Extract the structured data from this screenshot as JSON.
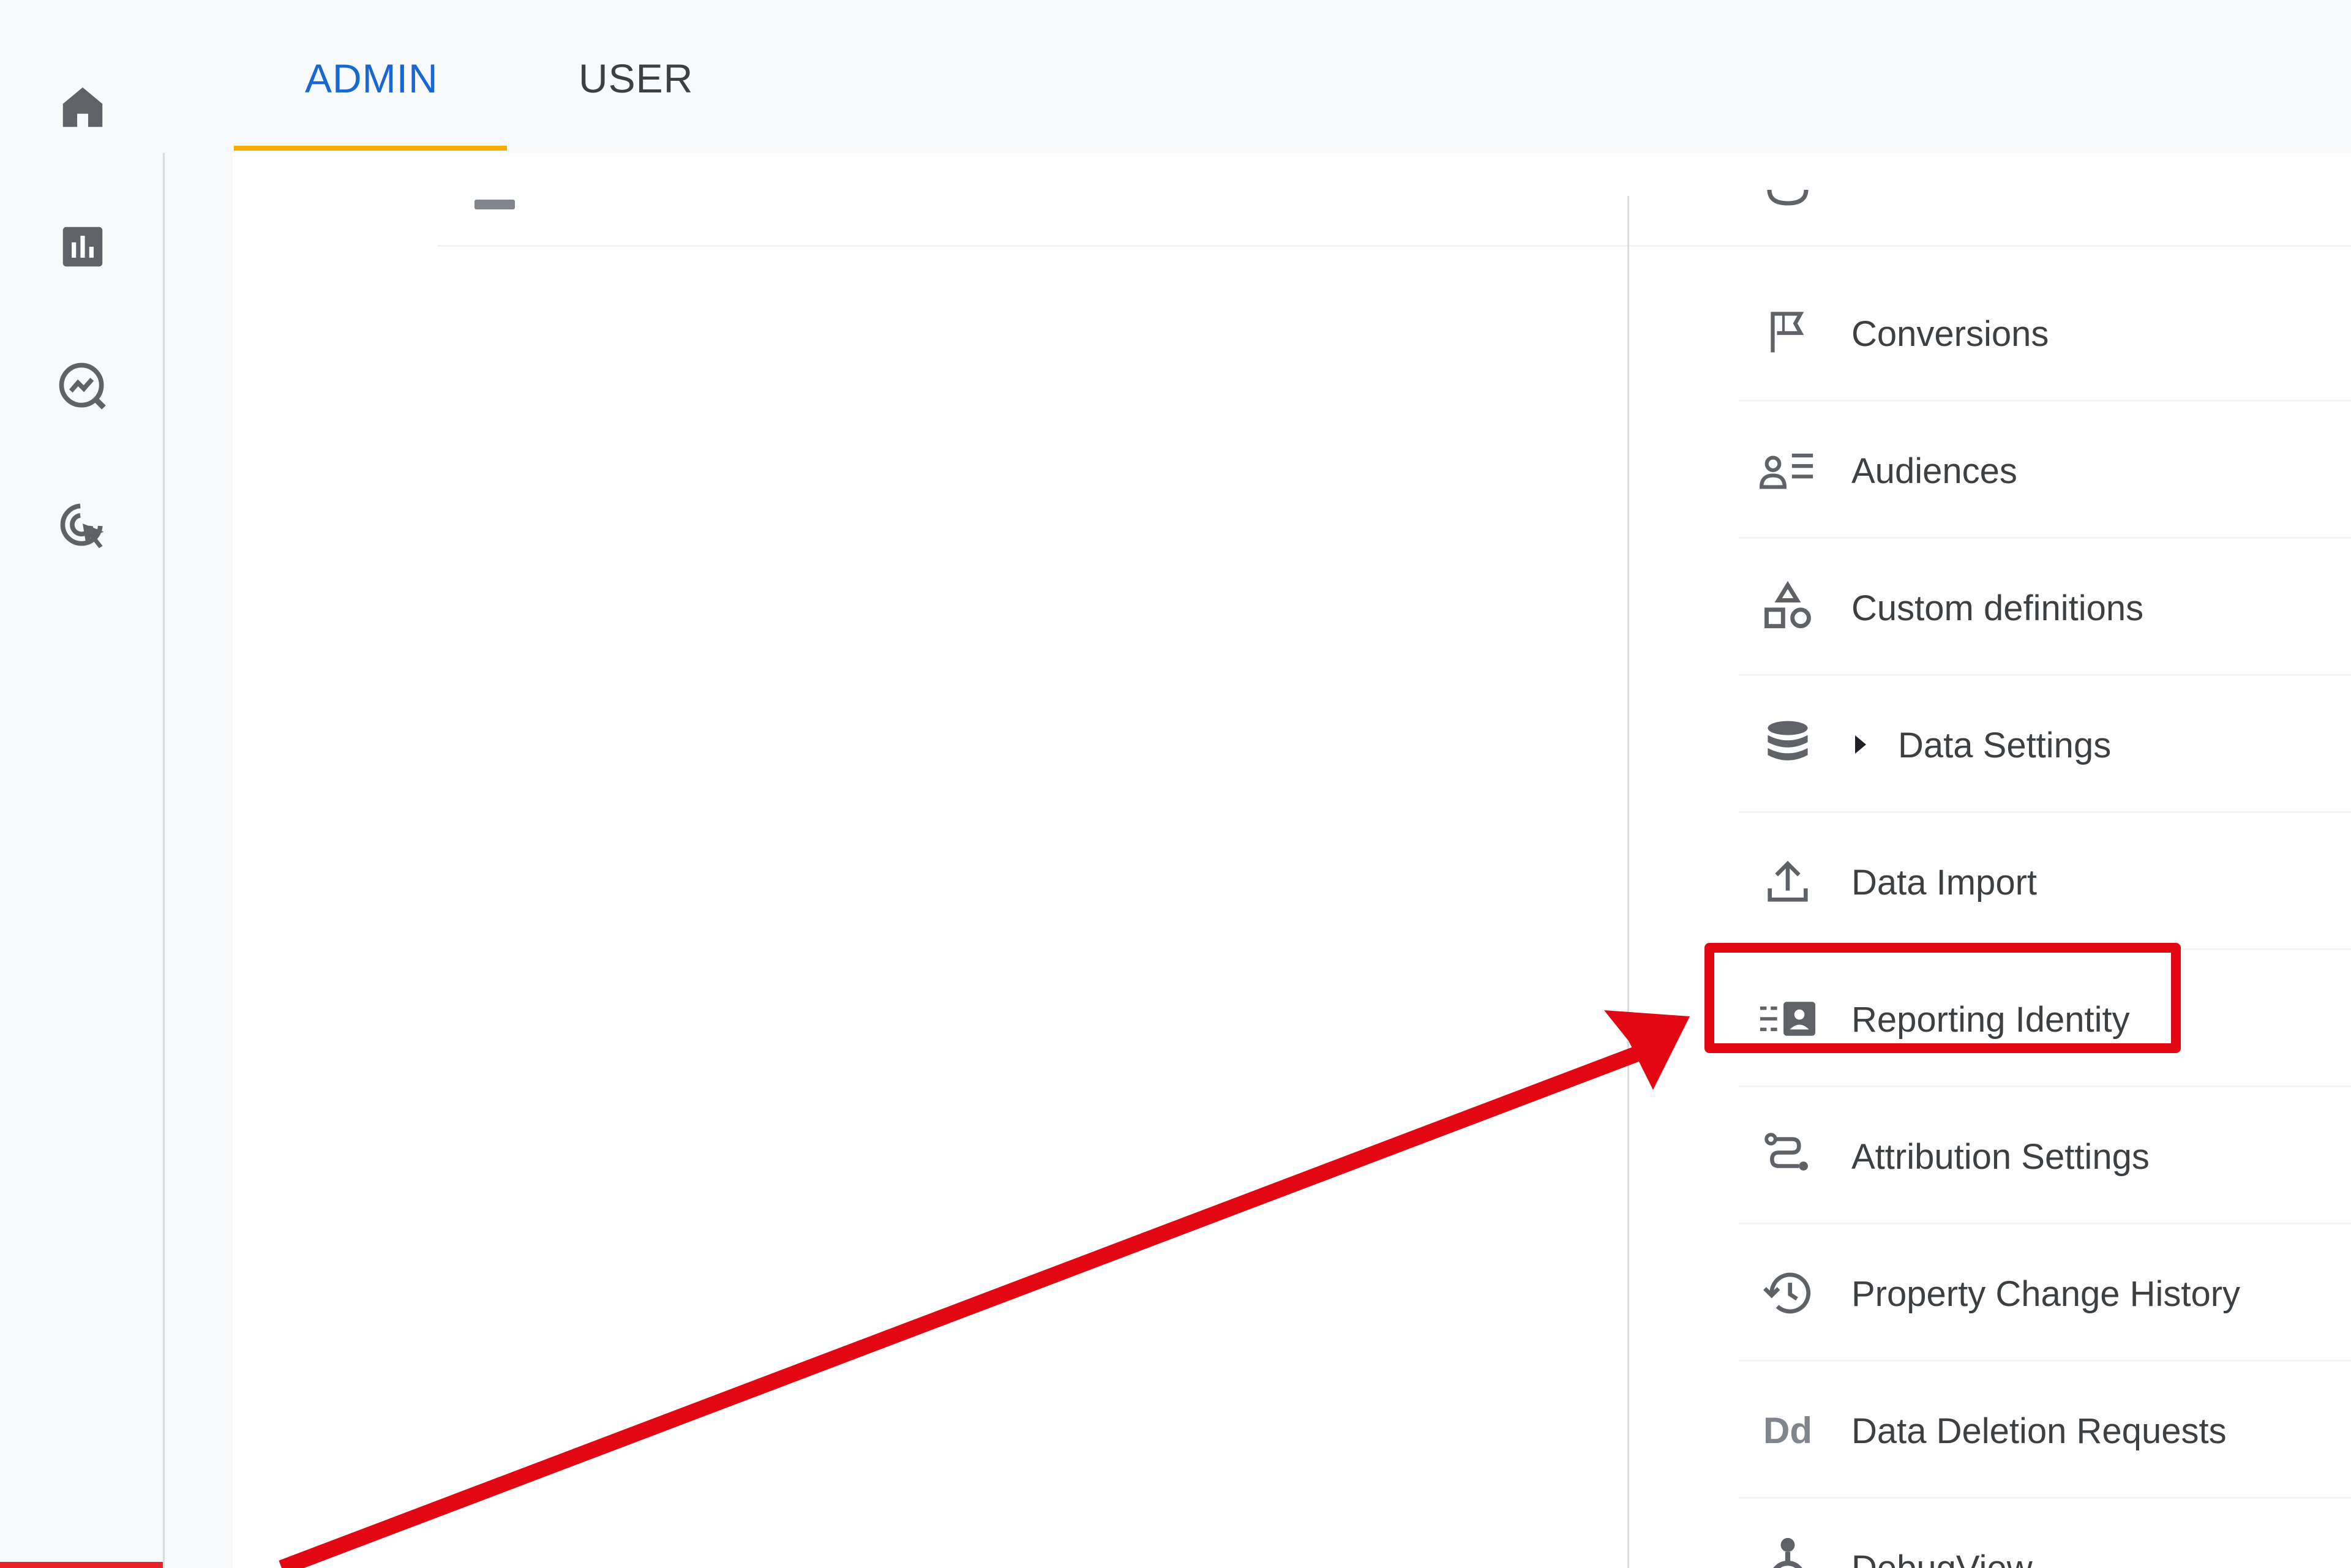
{
  "tabs": {
    "admin_label": "ADMIN",
    "user_label": "USER",
    "active": "ADMIN"
  },
  "rail": {
    "icons": [
      "home-icon",
      "reports-icon",
      "explore-icon",
      "advertising-icon"
    ]
  },
  "menu": {
    "items": [
      {
        "label": "Conversions",
        "icon": "flag-icon"
      },
      {
        "label": "Audiences",
        "icon": "audiences-icon"
      },
      {
        "label": "Custom definitions",
        "icon": "shapes-icon"
      },
      {
        "label": "Data Settings",
        "icon": "database-icon",
        "expandable": true
      },
      {
        "label": "Data Import",
        "icon": "upload-icon"
      },
      {
        "label": "Reporting Identity",
        "icon": "reporting-identity-icon",
        "highlighted": true
      },
      {
        "label": "Attribution Settings",
        "icon": "attribution-icon"
      },
      {
        "label": "Property Change History",
        "icon": "history-icon"
      },
      {
        "label": "Data Deletion Requests",
        "icon": "dd-icon",
        "icon_text": "Dd"
      },
      {
        "label": "DebugView",
        "icon": "debug-icon"
      }
    ]
  },
  "colors": {
    "accent_blue": "#1967d2",
    "tab_underline": "#f9ab00",
    "highlight_red": "#e30613",
    "icon_gray": "#5f6368"
  }
}
